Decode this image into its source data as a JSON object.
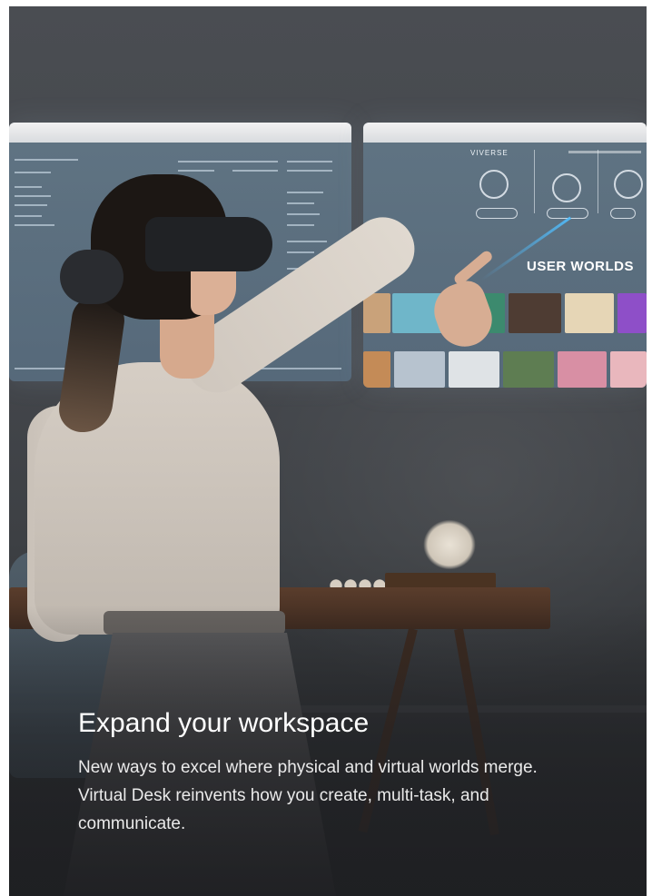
{
  "hero": {
    "title": "Expand your workspace",
    "description": "New ways to excel where physical and virtual worlds merge. Virtual Desk reinvents how you create, multi-task, and communicate."
  },
  "virtual_screens": {
    "right": {
      "brand": "VIVERSE",
      "section_title": "USER WORLDS"
    }
  },
  "colors": {
    "background": "#ffffff",
    "card": "#43464b",
    "title_text": "#ffffff",
    "body_text": "#eaeaea",
    "accent_glow": "#50beff"
  }
}
